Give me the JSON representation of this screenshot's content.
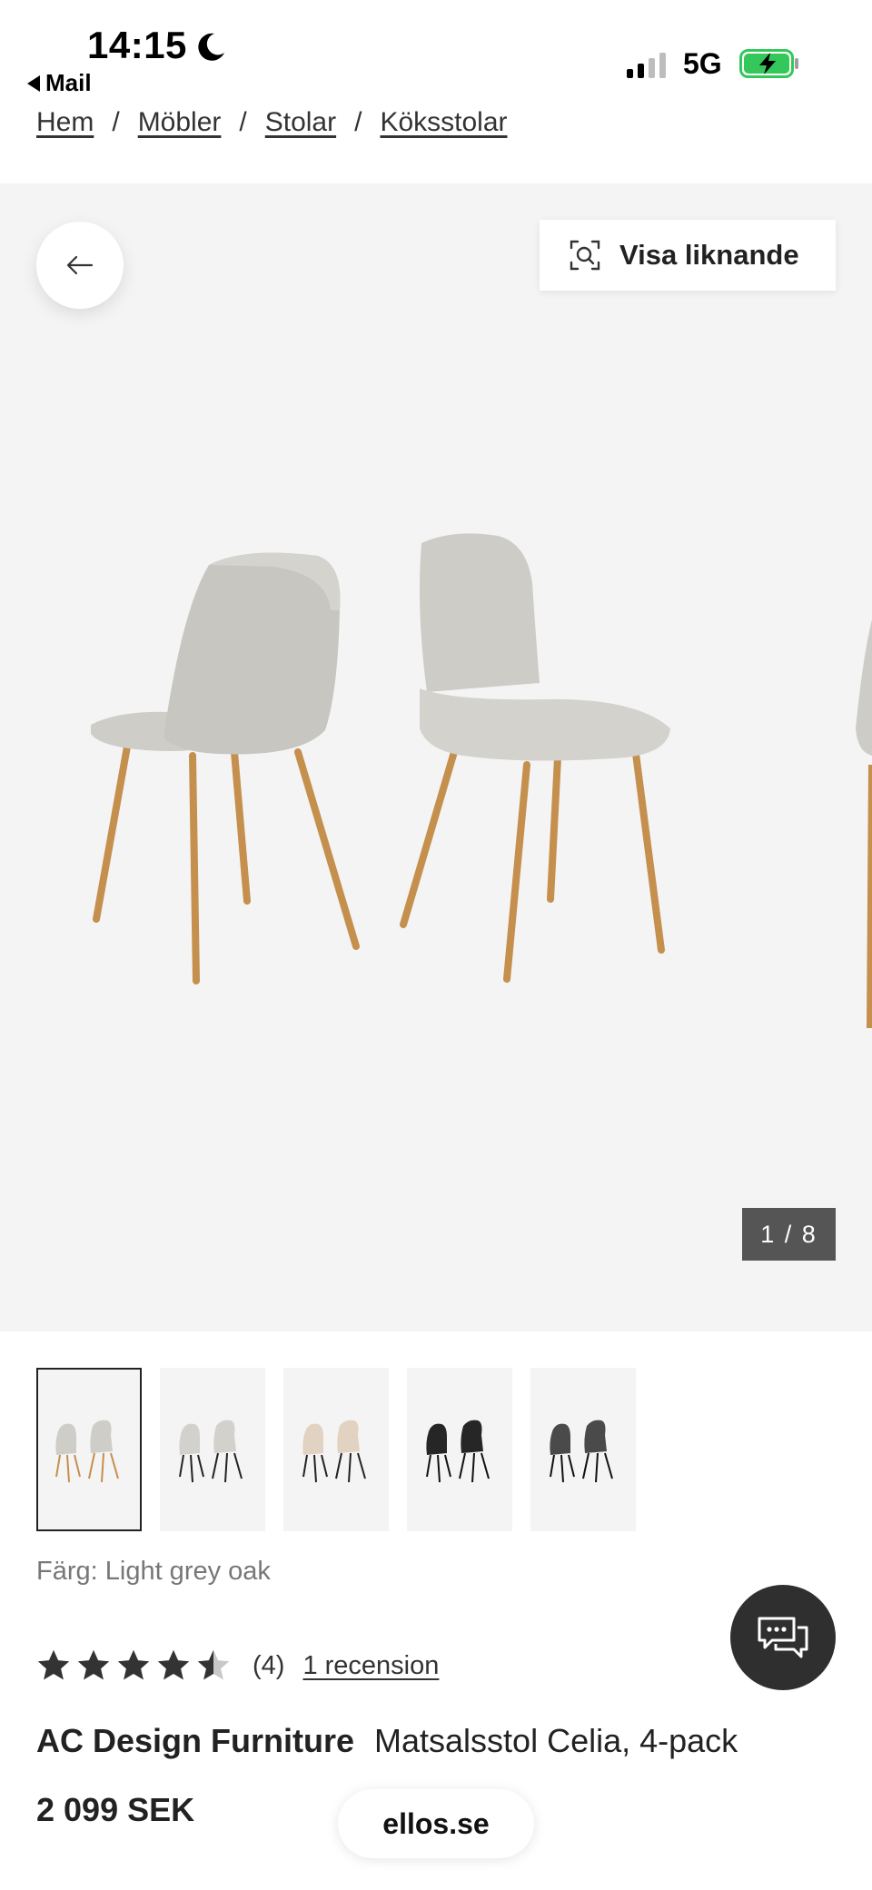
{
  "status_bar": {
    "time": "14:15",
    "back_app": "Mail",
    "network": "5G"
  },
  "breadcrumb": [
    "Hem",
    "Möbler",
    "Stolar",
    "Köksstolar"
  ],
  "breadcrumb_separator": "/",
  "gallery": {
    "similar_button_label": "Visa liknande",
    "image_counter": "1 / 8",
    "current_image": 1,
    "total_images": 8
  },
  "thumbnails": [
    {
      "variant": "light grey oak",
      "selected": true
    },
    {
      "variant": "light grey black",
      "selected": false
    },
    {
      "variant": "beige black",
      "selected": false
    },
    {
      "variant": "black black",
      "selected": false
    },
    {
      "variant": "dark grey black",
      "selected": false
    }
  ],
  "product": {
    "color_label": "Färg: Light grey oak",
    "rating": 4.5,
    "rating_max": 5,
    "rating_count": "(4)",
    "review_link": "1 recension",
    "brand": "AC Design Furniture",
    "name": "Matsalsstol Celia, 4-pack",
    "price": "2 099 SEK"
  },
  "browser": {
    "site": "ellos.se"
  },
  "colors": {
    "gallery_bg": "#f4f4f4",
    "counter_bg": "#555555",
    "chat_bg": "#2f2f2f",
    "battery_green": "#34c759"
  },
  "icons": [
    "moon-icon",
    "back-arrow-icon",
    "visual-search-icon",
    "chat-icon",
    "star-icon",
    "battery-charging-icon"
  ]
}
